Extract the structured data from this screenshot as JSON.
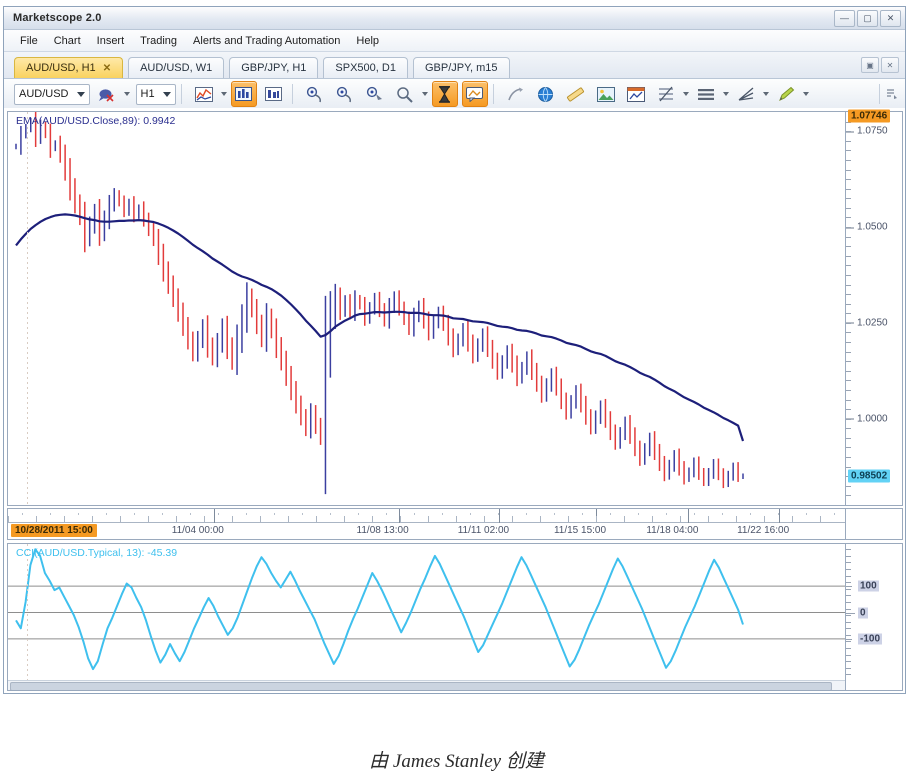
{
  "window": {
    "title": "Marketscope 2.0",
    "controls": [
      {
        "name": "minimize",
        "glyph": "—"
      },
      {
        "name": "maximize",
        "glyph": "▢"
      },
      {
        "name": "close",
        "glyph": "✕"
      }
    ]
  },
  "menu": {
    "items": [
      "File",
      "Chart",
      "Insert",
      "Trading",
      "Alerts and Trading Automation",
      "Help"
    ]
  },
  "tabs": {
    "items": [
      {
        "label": "AUD/USD, H1",
        "active": true,
        "close": "✕"
      },
      {
        "label": "AUD/USD, W1",
        "active": false
      },
      {
        "label": "GBP/JPY, H1",
        "active": false
      },
      {
        "label": "SPX500, D1",
        "active": false
      },
      {
        "label": "GBP/JPY, m15",
        "active": false
      }
    ],
    "controls": [
      "▣",
      "✕"
    ]
  },
  "toolbar": {
    "symbol": "AUD/USD",
    "timeframe": "H1",
    "buttons": [
      {
        "name": "indicator-icon",
        "active": false
      },
      {
        "name": "chart-type-line-icon",
        "active": false
      },
      {
        "name": "chart-type-bar-icon",
        "active": true
      },
      {
        "name": "chart-type-candle-icon",
        "active": false
      },
      {
        "name": "zoom-in-icon",
        "active": false
      },
      {
        "name": "zoom-out-icon",
        "active": false
      },
      {
        "name": "zoom-fit-icon",
        "active": false
      },
      {
        "name": "magnifier-icon",
        "active": false
      },
      {
        "name": "hourglass-icon",
        "active": true
      },
      {
        "name": "tooltip-icon",
        "active": true
      },
      {
        "name": "pen-tool-icon",
        "active": false
      },
      {
        "name": "globe-icon",
        "active": false
      },
      {
        "name": "ruler-icon",
        "active": false
      },
      {
        "name": "image-icon",
        "active": false
      },
      {
        "name": "window-icon",
        "active": false
      },
      {
        "name": "fibonacci-icon",
        "active": false
      },
      {
        "name": "horizontal-lines-icon",
        "active": false
      },
      {
        "name": "rays-icon",
        "active": false
      },
      {
        "name": "pencil-icon",
        "active": false
      }
    ]
  },
  "chart_data": {
    "type": "line",
    "title": "AUD/USD H1 price chart with EMA overlay and CCI oscillator",
    "price_pane": {
      "label": "EMA(AUD/USD.Close,89): 0.9942",
      "ylabel": "",
      "ylim": [
        0.9775,
        1.08
      ],
      "yticks": [
        1.075,
        1.05,
        1.025,
        1.0
      ],
      "ytick_labels": [
        "1.0750",
        "1.0500",
        "1.0250",
        "1.0000"
      ],
      "high_badge": "1.07746",
      "last_price_badge": "0.98502",
      "last_price": 0.98502,
      "ema_last": 0.9942,
      "series": [
        {
          "name": "AUD/USD OHLC bars",
          "type": "ohlc",
          "up_color": "#3b3fa0",
          "down_color": "#e23b3b",
          "closes": [
            1.071,
            1.0742,
            1.0758,
            1.0774,
            1.0735,
            1.0762,
            1.0744,
            1.0706,
            1.0718,
            1.0688,
            1.0648,
            1.0601,
            1.0562,
            1.0528,
            1.0472,
            1.0505,
            1.0538,
            1.0486,
            1.052,
            1.0558,
            1.0584,
            1.0566,
            1.0542,
            1.0561,
            1.0532,
            1.0548,
            1.052,
            1.0494,
            1.0468,
            1.0428,
            1.0386,
            1.035,
            1.0315,
            1.0278,
            1.0241,
            1.0205,
            1.0172,
            1.0206,
            1.0238,
            1.0191,
            1.016,
            1.0198,
            1.0236,
            1.0188,
            1.0152,
            1.0208,
            1.0262,
            1.0318,
            1.0286,
            1.0247,
            1.0211,
            1.0265,
            1.0232,
            1.0188,
            1.0151,
            1.0112,
            1.0074,
            1.0038,
            1.0005,
            0.9975,
            1.0014,
            0.9982,
            0.9952,
            1.0172,
            1.0268,
            1.0318,
            1.0282,
            1.0306,
            1.0278,
            1.0312,
            1.0296,
            1.0264,
            1.0288,
            1.0312,
            1.0284,
            1.0258,
            1.0292,
            1.0316,
            1.0288,
            1.0262,
            1.0236,
            1.0268,
            1.0292,
            1.0258,
            1.0226,
            1.0252,
            1.0276,
            1.0248,
            1.0214,
            1.0182,
            1.0206,
            1.0232,
            1.0198,
            1.0166,
            1.0192,
            1.0218,
            1.0184,
            1.0152,
            1.0122,
            1.0148,
            1.0174,
            1.0142,
            1.0108,
            1.0132,
            1.0158,
            1.0124,
            1.0092,
            1.0062,
            1.0088,
            1.0114,
            1.0082,
            1.0048,
            1.0018,
            1.0044,
            1.007,
            1.0038,
            1.0006,
            0.9978,
            1.0004,
            1.003,
            0.9998,
            0.9966,
            0.9938,
            0.9962,
            0.9988,
            0.9956,
            0.9924,
            0.9896,
            0.992,
            0.9946,
            0.9914,
            0.9884,
            0.9856,
            0.9878,
            0.9902,
            0.9872,
            0.9846,
            0.9862,
            0.9884,
            0.9858,
            0.9838,
            0.9858,
            0.988,
            0.9856,
            0.9834,
            0.9852,
            0.9872,
            0.985,
            0.985
          ]
        },
        {
          "name": "EMA(89)",
          "type": "line",
          "color": "#1d1f7a",
          "width": 2.2,
          "values": [
            1.0452,
            1.0468,
            1.0482,
            1.0495,
            1.0505,
            1.0514,
            1.0521,
            1.0526,
            1.053,
            1.0532,
            1.0533,
            1.0532,
            1.053,
            1.0527,
            1.0523,
            1.052,
            1.0518,
            1.0515,
            1.0514,
            1.0514,
            1.0515,
            1.0516,
            1.0516,
            1.0517,
            1.0517,
            1.0518,
            1.0517,
            1.0515,
            1.0513,
            1.0509,
            1.0504,
            1.0498,
            1.0491,
            1.0483,
            1.0474,
            1.0464,
            1.0454,
            1.0445,
            1.0437,
            1.0428,
            1.0418,
            1.041,
            1.0402,
            1.0393,
            1.0384,
            1.0377,
            1.0371,
            1.0367,
            1.0362,
            1.0356,
            1.0349,
            1.0344,
            1.0338,
            1.033,
            1.0321,
            1.031,
            1.0298,
            1.0285,
            1.0271,
            1.0256,
            1.0243,
            1.0229,
            1.0214,
            1.0218,
            1.0228,
            1.024,
            1.0248,
            1.0256,
            1.0262,
            1.0269,
            1.0273,
            1.0274,
            1.0276,
            1.0278,
            1.0278,
            1.0277,
            1.0278,
            1.0279,
            1.0279,
            1.0278,
            1.0276,
            1.0276,
            1.0276,
            1.0274,
            1.0271,
            1.027,
            1.027,
            1.0269,
            1.0266,
            1.0262,
            1.0261,
            1.026,
            1.0257,
            1.0254,
            1.0253,
            1.0252,
            1.025,
            1.0246,
            1.0242,
            1.024,
            1.0239,
            1.0236,
            1.0232,
            1.023,
            1.0229,
            1.0226,
            1.0222,
            1.0217,
            1.0215,
            1.0213,
            1.0209,
            1.0204,
            1.0198,
            1.0195,
            1.0192,
            1.0188,
            1.0182,
            1.0176,
            1.0172,
            1.0169,
            1.0164,
            1.0157,
            1.015,
            1.0145,
            1.0141,
            1.0135,
            1.0128,
            1.012,
            1.0114,
            1.0109,
            1.0102,
            1.0094,
            1.0085,
            1.0078,
            1.0072,
            1.0064,
            1.0056,
            1.005,
            1.0044,
            1.0037,
            1.0029,
            1.0023,
            1.0017,
            1.001,
            1.0002,
            0.9996,
            0.9989,
            0.9982,
            0.9942
          ]
        }
      ]
    },
    "time_axis": {
      "label_badge": "10/28/2011 15:00",
      "ticks": [
        "11/04 00:00",
        "11/08 13:00",
        "11/11 02:00",
        "11/15 15:00",
        "11/18 04:00",
        "11/22 16:00"
      ],
      "tick_positions": [
        0.245,
        0.465,
        0.585,
        0.7,
        0.81,
        0.918
      ]
    },
    "cci_pane": {
      "label": "CCI(AUD/USD.Typical, 13): -45.39",
      "color": "#3fc0ee",
      "ylim": [
        -260,
        260
      ],
      "yticks": [
        100,
        0,
        -100
      ],
      "ytick_labels": [
        "100",
        "0",
        "-100"
      ],
      "last_value": -45.39,
      "values": [
        -30,
        -60,
        40,
        180,
        240,
        215,
        150,
        120,
        85,
        95,
        60,
        25,
        -10,
        -55,
        -110,
        -175,
        -215,
        -185,
        -120,
        -60,
        -20,
        25,
        70,
        110,
        95,
        55,
        20,
        -30,
        -90,
        -145,
        -190,
        -160,
        -120,
        -155,
        -185,
        -150,
        -105,
        -60,
        -20,
        20,
        55,
        25,
        -15,
        -50,
        -85,
        -60,
        -20,
        30,
        80,
        130,
        175,
        210,
        185,
        150,
        120,
        95,
        125,
        155,
        120,
        80,
        45,
        10,
        -25,
        -70,
        -115,
        -155,
        -195,
        -165,
        -120,
        -70,
        -25,
        15,
        60,
        105,
        150,
        120,
        85,
        45,
        5,
        -35,
        -75,
        -40,
        0,
        45,
        90,
        130,
        175,
        215,
        185,
        145,
        105,
        65,
        25,
        -15,
        -60,
        -105,
        -150,
        -125,
        -85,
        -45,
        -5,
        35,
        80,
        125,
        170,
        210,
        180,
        140,
        100,
        60,
        20,
        -25,
        -70,
        -115,
        -160,
        -205,
        -180,
        -140,
        -95,
        -50,
        -10,
        30,
        75,
        120,
        165,
        205,
        175,
        135,
        95,
        55,
        15,
        -30,
        -75,
        -120,
        -165,
        -210,
        -185,
        -145,
        -100,
        -55,
        -15,
        25,
        70,
        115,
        160,
        200,
        170,
        130,
        90,
        50,
        10,
        -45.39
      ]
    }
  },
  "caption": "由 James Stanley 创建"
}
